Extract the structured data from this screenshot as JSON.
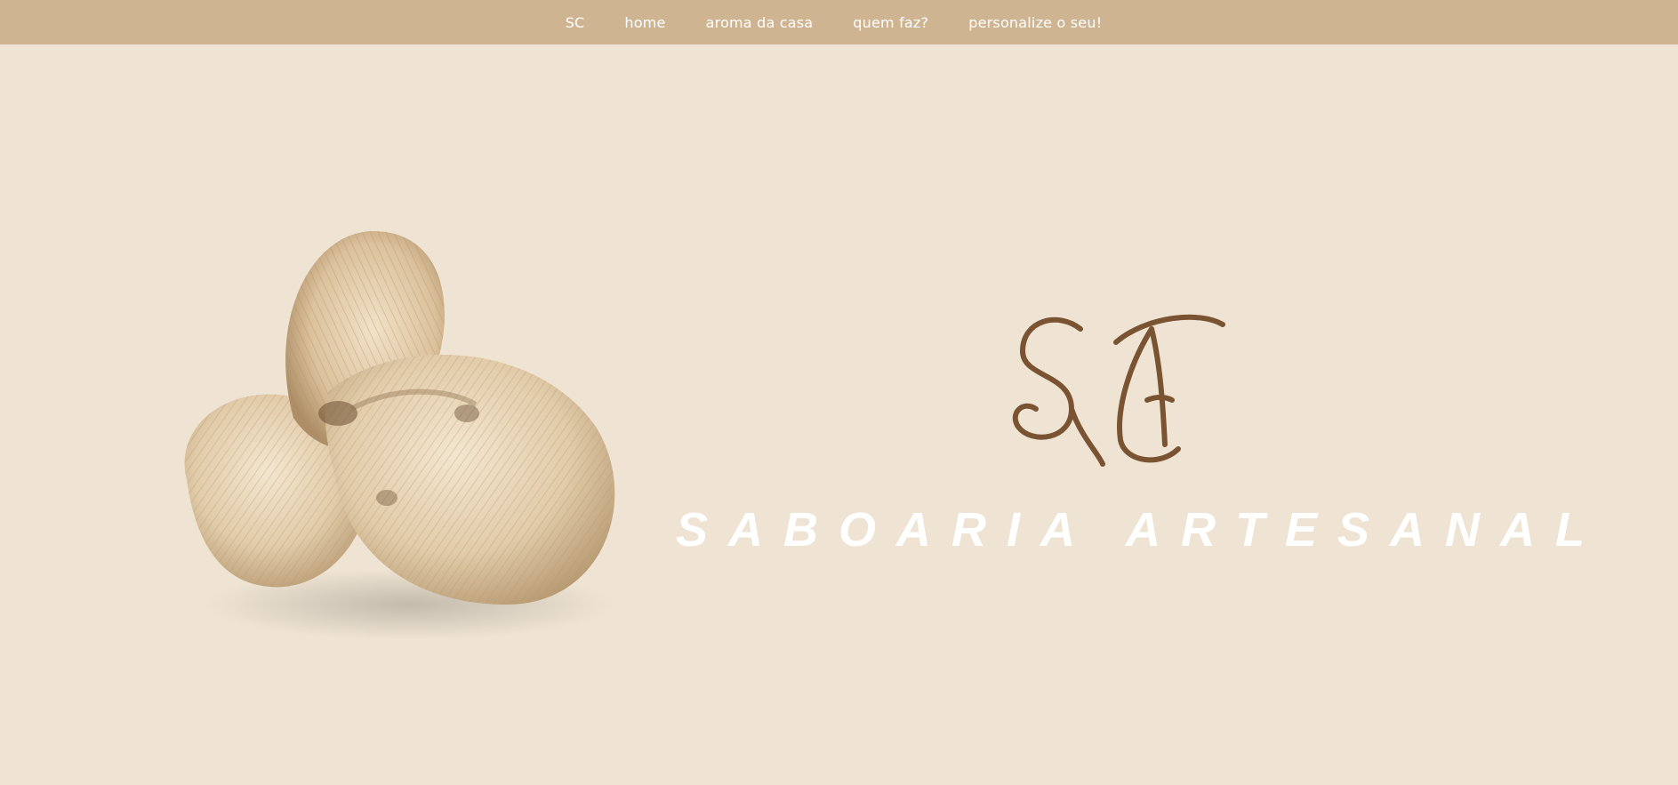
{
  "nav": {
    "items": [
      {
        "label": "SC"
      },
      {
        "label": "home"
      },
      {
        "label": "aroma da casa"
      },
      {
        "label": "quem faz?"
      },
      {
        "label": "personalize o seu!"
      }
    ]
  },
  "hero": {
    "logo_monogram": "SA",
    "tagline": "SABOARIA ARTESANAL",
    "image_icon": "knotted-soap-sculpture"
  },
  "colors": {
    "nav_bg": "#cfb492",
    "page_bg": "#efe4d3",
    "logo": "#7a5332",
    "tagline": "#ffffff"
  }
}
